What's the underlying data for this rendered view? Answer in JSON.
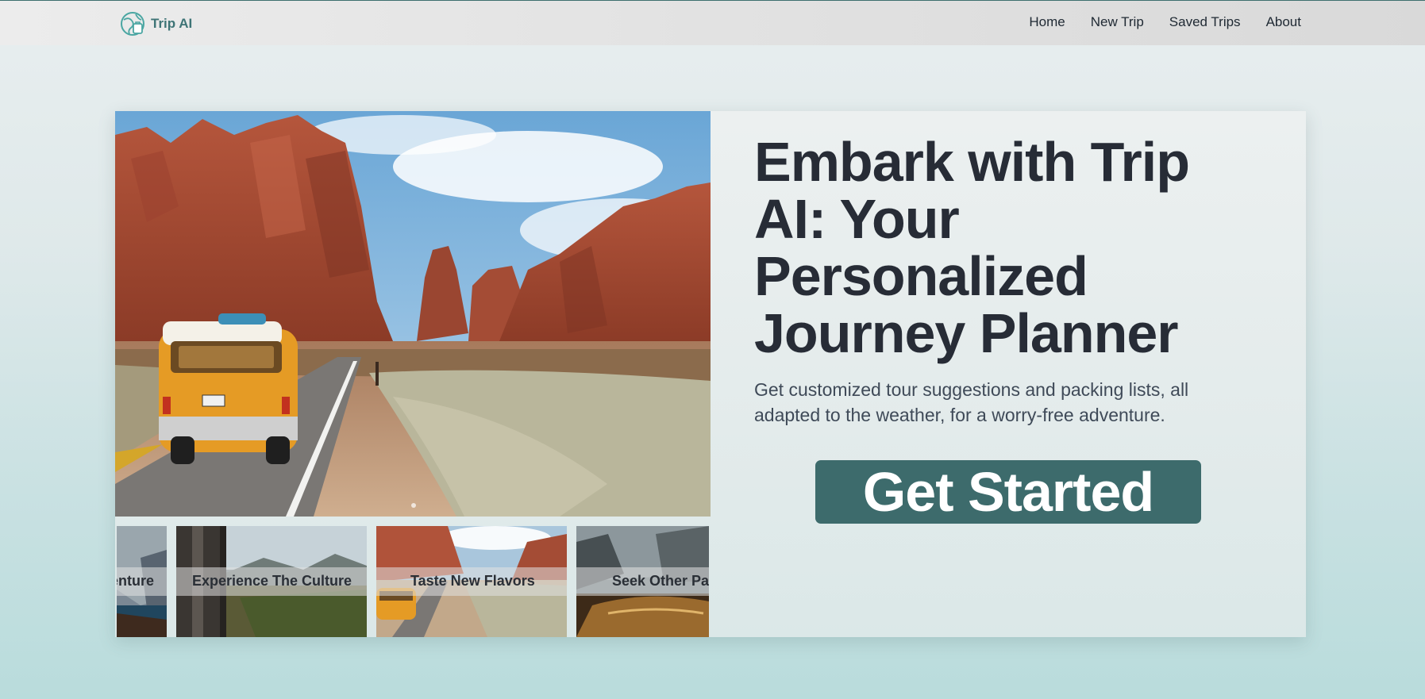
{
  "nav": {
    "brand_name": "Trip AI",
    "links": [
      "Home",
      "New Trip",
      "Saved Trips",
      "About"
    ]
  },
  "hero": {
    "headline": "Embark with Trip AI: Your Personalized Journey Planner",
    "subtitle": "Get customized tour suggestions and packing lists, all adapted to the weather, for a worry-free adventure.",
    "cta_label": "Get Started"
  },
  "carousel": {
    "thumbnails": [
      {
        "label": "Seek Adventure"
      },
      {
        "label": "Experience The Culture"
      },
      {
        "label": "Taste New Flavors"
      },
      {
        "label": "Seek Other Paths"
      }
    ]
  },
  "colors": {
    "accent": "#3d6b6c",
    "brand": "#3e7476",
    "headline": "#272c36"
  }
}
